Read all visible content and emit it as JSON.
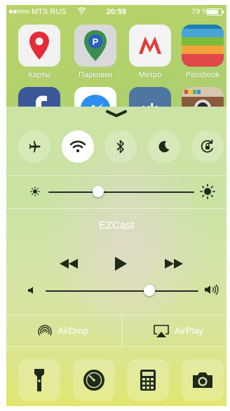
{
  "status_bar": {
    "carrier": "MTS RUS",
    "time": "20:59",
    "battery_percent": "79 %",
    "battery_level": 0.79,
    "signal_bars_filled": 2,
    "signal_bars_total": 5
  },
  "home_apps": [
    {
      "label": "Карты"
    },
    {
      "label": "Парковки"
    },
    {
      "label": "Метро"
    },
    {
      "label": "Passbook"
    }
  ],
  "control_center": {
    "toggles": {
      "airplane": false,
      "wifi": true,
      "bluetooth": false,
      "do_not_disturb": false,
      "rotation_lock": false
    },
    "brightness": 0.34,
    "now_playing": "EZCast",
    "volume": 0.68,
    "airdrop_label": "AirDrop",
    "airplay_label": "AirPlay"
  },
  "icons": {
    "airplane": "airplane-icon",
    "wifi": "wifi-icon",
    "bluetooth": "bluetooth-icon",
    "dnd": "moon-icon",
    "rotation": "rotation-lock-icon",
    "flashlight": "flashlight-icon",
    "timer": "timer-icon",
    "calculator": "calculator-icon",
    "camera": "camera-icon"
  },
  "colors": {
    "accent_red": "#e52a38",
    "metro_red": "#e53b3b",
    "parking_green": "#3a8f4f",
    "facebook_blue": "#3b5998",
    "vk_blue": "#4d76a1",
    "icon_dark": "#1f2a1a"
  }
}
